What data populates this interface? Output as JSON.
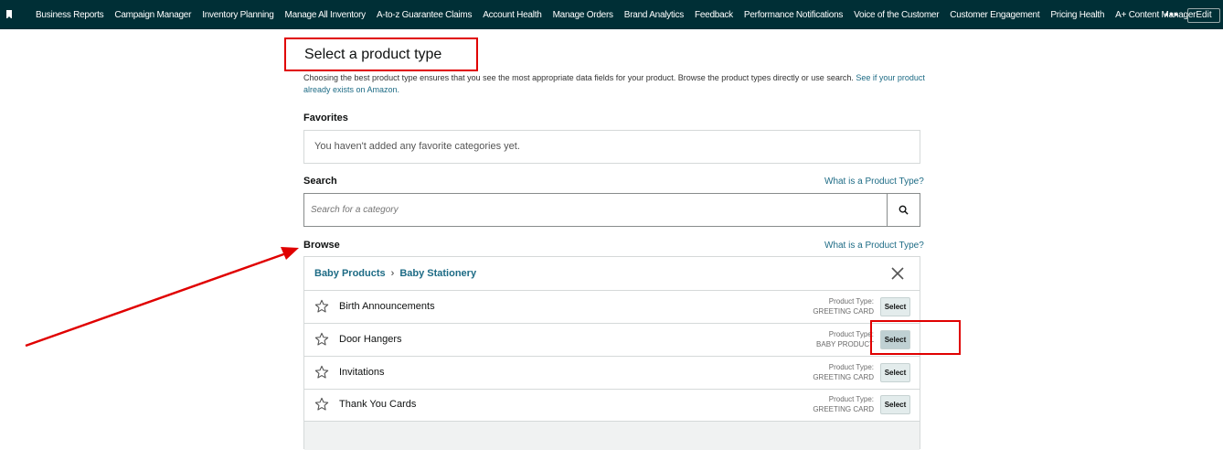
{
  "topbar": {
    "links": [
      "Business Reports",
      "Campaign Manager",
      "Inventory Planning",
      "Manage All Inventory",
      "A-to-z Guarantee Claims",
      "Account Health",
      "Manage Orders",
      "Brand Analytics",
      "Feedback",
      "Performance Notifications",
      "Voice of the Customer",
      "Customer Engagement",
      "Pricing Health",
      "A+ Content Manager"
    ],
    "more": "•••",
    "edit_label": "Edit"
  },
  "page": {
    "title": "Select a product type",
    "description": "Choosing the best product type ensures that you see the most appropriate data fields for your product. Browse the product types directly or use search.",
    "description_link": "See if your product already exists on Amazon."
  },
  "favorites": {
    "label": "Favorites",
    "empty_text": "You haven't added any favorite categories yet."
  },
  "search": {
    "label": "Search",
    "help_link": "What is a Product Type?",
    "placeholder": "Search for a category"
  },
  "browse": {
    "label": "Browse",
    "help_link": "What is a Product Type?",
    "breadcrumb": [
      "Baby Products",
      "Baby Stationery"
    ],
    "rows": [
      {
        "name": "Birth Announcements",
        "pt_label": "Product Type:",
        "pt_value": "GREETING CARD",
        "select": "Select"
      },
      {
        "name": "Door Hangers",
        "pt_label": "Product Type:",
        "pt_value": "BABY PRODUCT",
        "select": "Select"
      },
      {
        "name": "Invitations",
        "pt_label": "Product Type:",
        "pt_value": "GREETING CARD",
        "select": "Select"
      },
      {
        "name": "Thank You Cards",
        "pt_label": "Product Type:",
        "pt_value": "GREETING CARD",
        "select": "Select"
      }
    ]
  },
  "colors": {
    "topbar": "#002f36",
    "link": "#1d6b85",
    "annotation": "#e00000"
  }
}
